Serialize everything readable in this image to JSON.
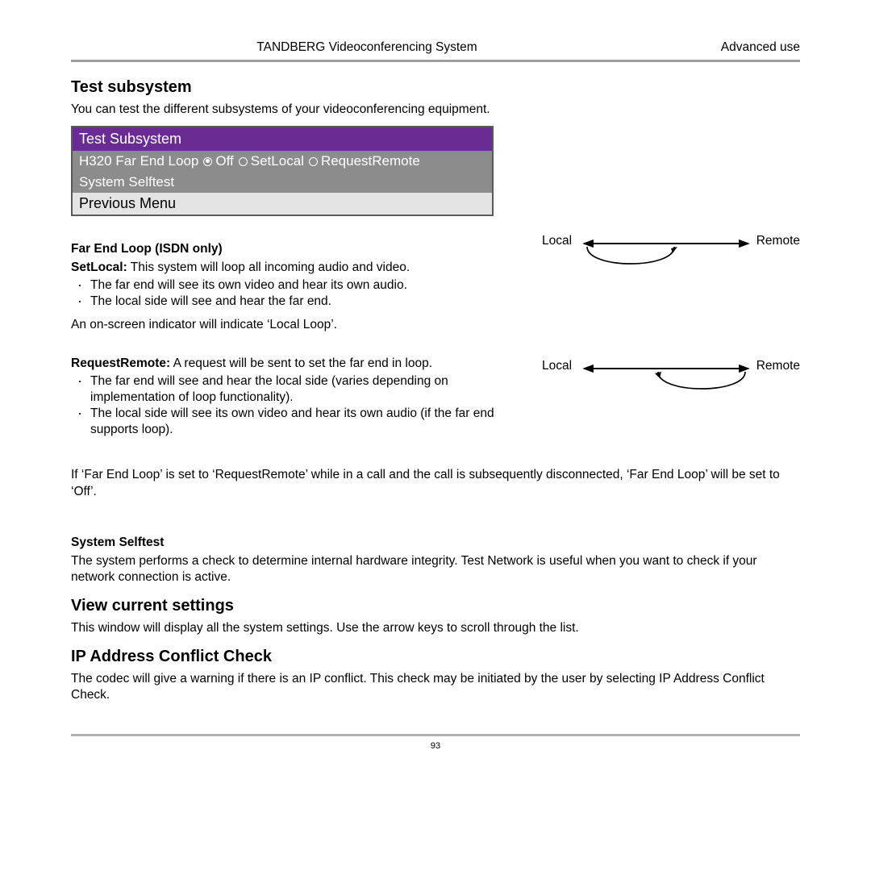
{
  "header": {
    "title": "TANDBERG Videoconferencing System",
    "section": "Advanced use"
  },
  "s1": {
    "heading": "Test subsystem",
    "intro": "You can test the different subsystems of your videoconferencing equipment."
  },
  "panel": {
    "title": "Test Subsystem",
    "row_label": "H320 Far End Loop",
    "opt_off": "Off",
    "opt_setlocal": "SetLocal",
    "opt_reqremote": "RequestRemote",
    "selftest": "System Selftest",
    "prev": "Previous Menu"
  },
  "farend": {
    "title": "Far End Loop (ISDN only)",
    "setlocal_bold": "SetLocal:",
    "setlocal_text": " This system will loop all incoming audio and video.",
    "setlocal_bul1": "The far end will see its own video and hear its own audio.",
    "setlocal_bul2": "The local side will see and hear the far end.",
    "setlocal_indicator": "An on-screen indicator will indicate ‘Local Loop’.",
    "reqremote_bold": "RequestRemote:",
    "reqremote_text": " A request will be sent to set the far end in loop.",
    "reqremote_bul1": "The far end will see and hear the local side (varies depending on implementation of loop functionality).",
    "reqremote_bul2": "The local side will see its own video and hear its own audio (if the far end supports loop).",
    "note": "If ‘Far End Loop’ is set to ‘RequestRemote’ while in a call and the call is subsequently disconnected, ‘Far End Loop’ will be set to ‘Off’."
  },
  "diagram": {
    "local": "Local",
    "remote": "Remote"
  },
  "selftest": {
    "title": "System Selftest",
    "body": "The system performs a check to determine internal hardware integrity. Test Network is useful when you want to check if your network connection is active."
  },
  "viewsettings": {
    "heading": "View current settings",
    "body": "This window will display all the system settings. Use the arrow keys to scroll through the list."
  },
  "ipcheck": {
    "heading": "IP Address Conflict Check",
    "body": "The codec will give a warning if there is an IP conflict. This check may be initiated by the user by selecting IP Address Conflict Check."
  },
  "page_number": "93"
}
